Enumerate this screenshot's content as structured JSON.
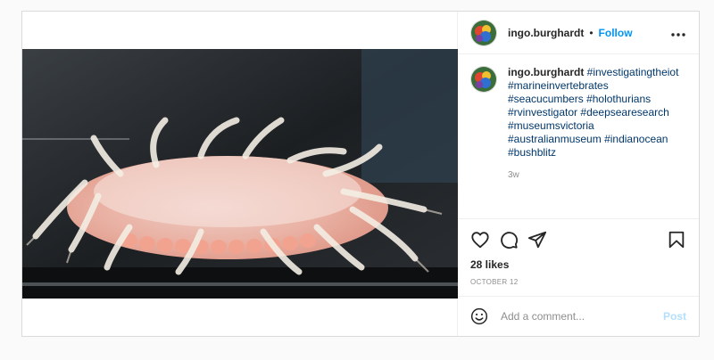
{
  "post": {
    "username": "ingo.burghardt",
    "dot": "•",
    "follow_label": "Follow",
    "more_label": "•••",
    "caption": {
      "username": "ingo.burghardt",
      "hashtags": [
        "#investigatingtheiot",
        "#marineinvertebrates",
        "#seacucumbers",
        "#holothurians",
        "#rvinvestigator",
        "#deepsearesearch",
        "#museumsvictoria",
        "#australianmuseum",
        "#indianocean",
        "#bushblitz"
      ],
      "time": "3w"
    },
    "likes": "28 likes",
    "date": "OCTOBER 12",
    "comment": {
      "placeholder": "Add a comment...",
      "post_label": "Post"
    },
    "icons": {
      "like": "heart-icon",
      "comment": "comment-bubble-icon",
      "share": "paper-plane-icon",
      "save": "bookmark-icon",
      "emoji": "emoji-smile-icon",
      "more": "more-options-icon"
    },
    "colors": {
      "accent": "#0095f6",
      "hashtag": "#00376b",
      "muted": "#8e8e8e",
      "post_disabled": "#b2dffc"
    }
  }
}
